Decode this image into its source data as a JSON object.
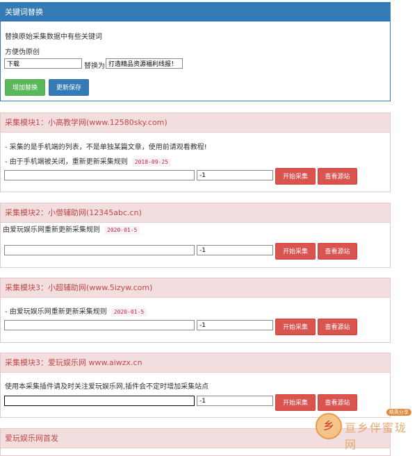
{
  "keyword_panel": {
    "title": "关键词替换",
    "desc_line1": "替换原始采集数据中有些关键词",
    "desc_line2": "方便伪原创",
    "find_value": "下载",
    "replace_label": "替换为",
    "replace_value": "打造精品资源福利线报！",
    "add_button": "增加替换",
    "save_button": "更新保存"
  },
  "modules": [
    {
      "title": "采集模块1：小高教学网(www.12580sky.com)",
      "line1": "- 采集的是手机端的列表，不是单独某篇文章，使用前请观看教程!",
      "line2": "- 由于手机端被关闭，重新更新采集规则",
      "date": "2018-09-25",
      "url_value": "",
      "page_value": "-1",
      "start_button": "开始采集",
      "view_button": "查看源站"
    },
    {
      "title": "采集模块2：小僧辅助网(12345abc.cn)",
      "line1": "由爱玩娱乐网重新更新采集规则",
      "date": "2020-01-5",
      "url_value": "",
      "page_value": "-1",
      "start_button": "开始采集",
      "view_button": "查看源站"
    },
    {
      "title": "采集模块3：小超辅助网(www.5izyw.com)",
      "line1": "- 由爱玩娱乐网重新更新采集规则",
      "date": "2020-01-5",
      "url_value": "",
      "page_value": "-1",
      "start_button": "开始采集",
      "view_button": "查看源站"
    },
    {
      "title": "采集模块3：爱玩娱乐网 www.aiwzx.cn",
      "line1": "使用本采集插件请及时关注爱玩娱乐网,插件会不定时增加采集站点",
      "url_value": "",
      "page_value": "-1",
      "start_button": "开始采集",
      "view_button": "查看源站"
    }
  ],
  "footer_panel": {
    "title": "爱玩娱乐网首发"
  },
  "watermark": {
    "tag": "精英分享",
    "text": "亘乡伴蜜珑网",
    "logo_char": "乡"
  }
}
